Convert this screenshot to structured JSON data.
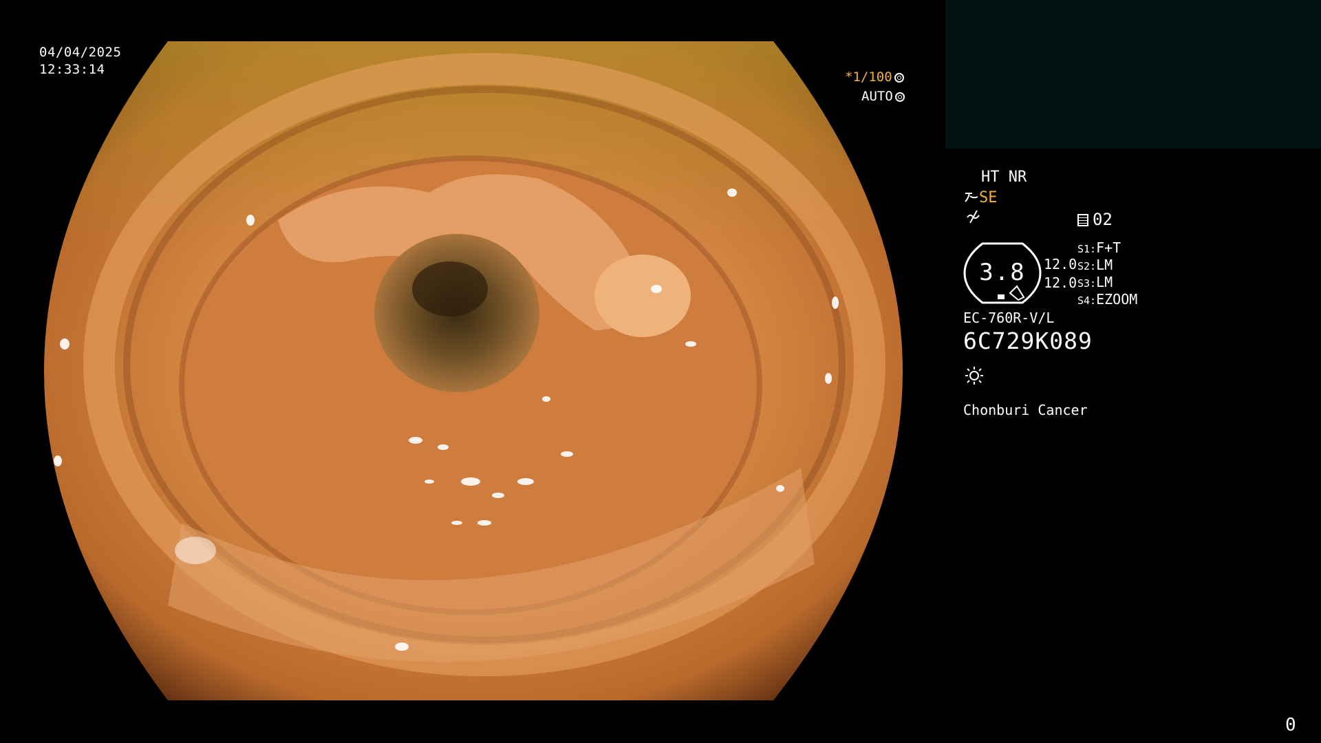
{
  "overlay": {
    "date": "04/04/2025",
    "time": "12:33:14",
    "shutter": "*1/100",
    "exposure_mode": "AUTO"
  },
  "info_panel": {
    "mode": "HT NR",
    "enhancement": "SE",
    "memo_number": "02",
    "gauge_value": "3.8",
    "gauge_side_top": "12.0",
    "gauge_side_bottom": "12.0",
    "switches": [
      {
        "key": "S1:",
        "value": "F+T"
      },
      {
        "key": "S2:",
        "value": "LM"
      },
      {
        "key": "S3:",
        "value": "LM"
      },
      {
        "key": "S4:",
        "value": "EZOOM"
      }
    ],
    "scope_model": "EC-760R-V/L",
    "serial": "6C729K089",
    "hospital": "Chonburi Cancer"
  },
  "footer": {
    "counter": "0"
  },
  "colors": {
    "background": "#000000",
    "accent_yellow": "#f3b23a",
    "thumb_panel": "#021412",
    "mucosa_base": "#c97a3c"
  },
  "icons": [
    "shutter-icon",
    "auto-exposure-icon",
    "enhance-icon",
    "tilde-icon",
    "memo-icon",
    "light-source-icon"
  ]
}
